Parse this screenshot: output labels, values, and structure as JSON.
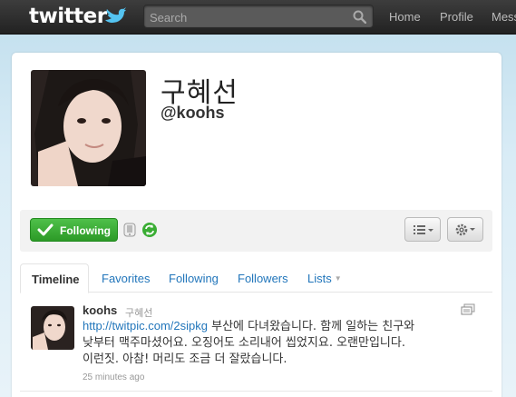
{
  "topbar": {
    "logo_text": "twitter",
    "search": {
      "placeholder": "Search",
      "value": ""
    },
    "nav": {
      "home": "Home",
      "profile": "Profile",
      "messages": "Mess"
    }
  },
  "profile": {
    "name": "구혜선",
    "handle": "@koohs"
  },
  "actions": {
    "following_label": "Following"
  },
  "tabs": {
    "timeline": "Timeline",
    "favorites": "Favorites",
    "following": "Following",
    "followers": "Followers",
    "lists": "Lists"
  },
  "tweet": {
    "screen_name": "koohs",
    "full_name": "구혜선",
    "link": "http://twitpic.com/2sipkg",
    "text_line1": " 부산에 다녀왔습니다. 함께 일하는 친구와",
    "text_line2": "낮부터 맥주마셨어요. 오징어도 소리내어 씹었지요. 오랜만입니다.",
    "text_line3": "이런짓. 아참! 머리도 조금 더 잘랐습니다.",
    "time": "25 minutes ago"
  },
  "colors": {
    "topbar": "#2b2b2b",
    "link": "#2276bb",
    "following_green": "#3aad34",
    "background": "#c0deed"
  }
}
